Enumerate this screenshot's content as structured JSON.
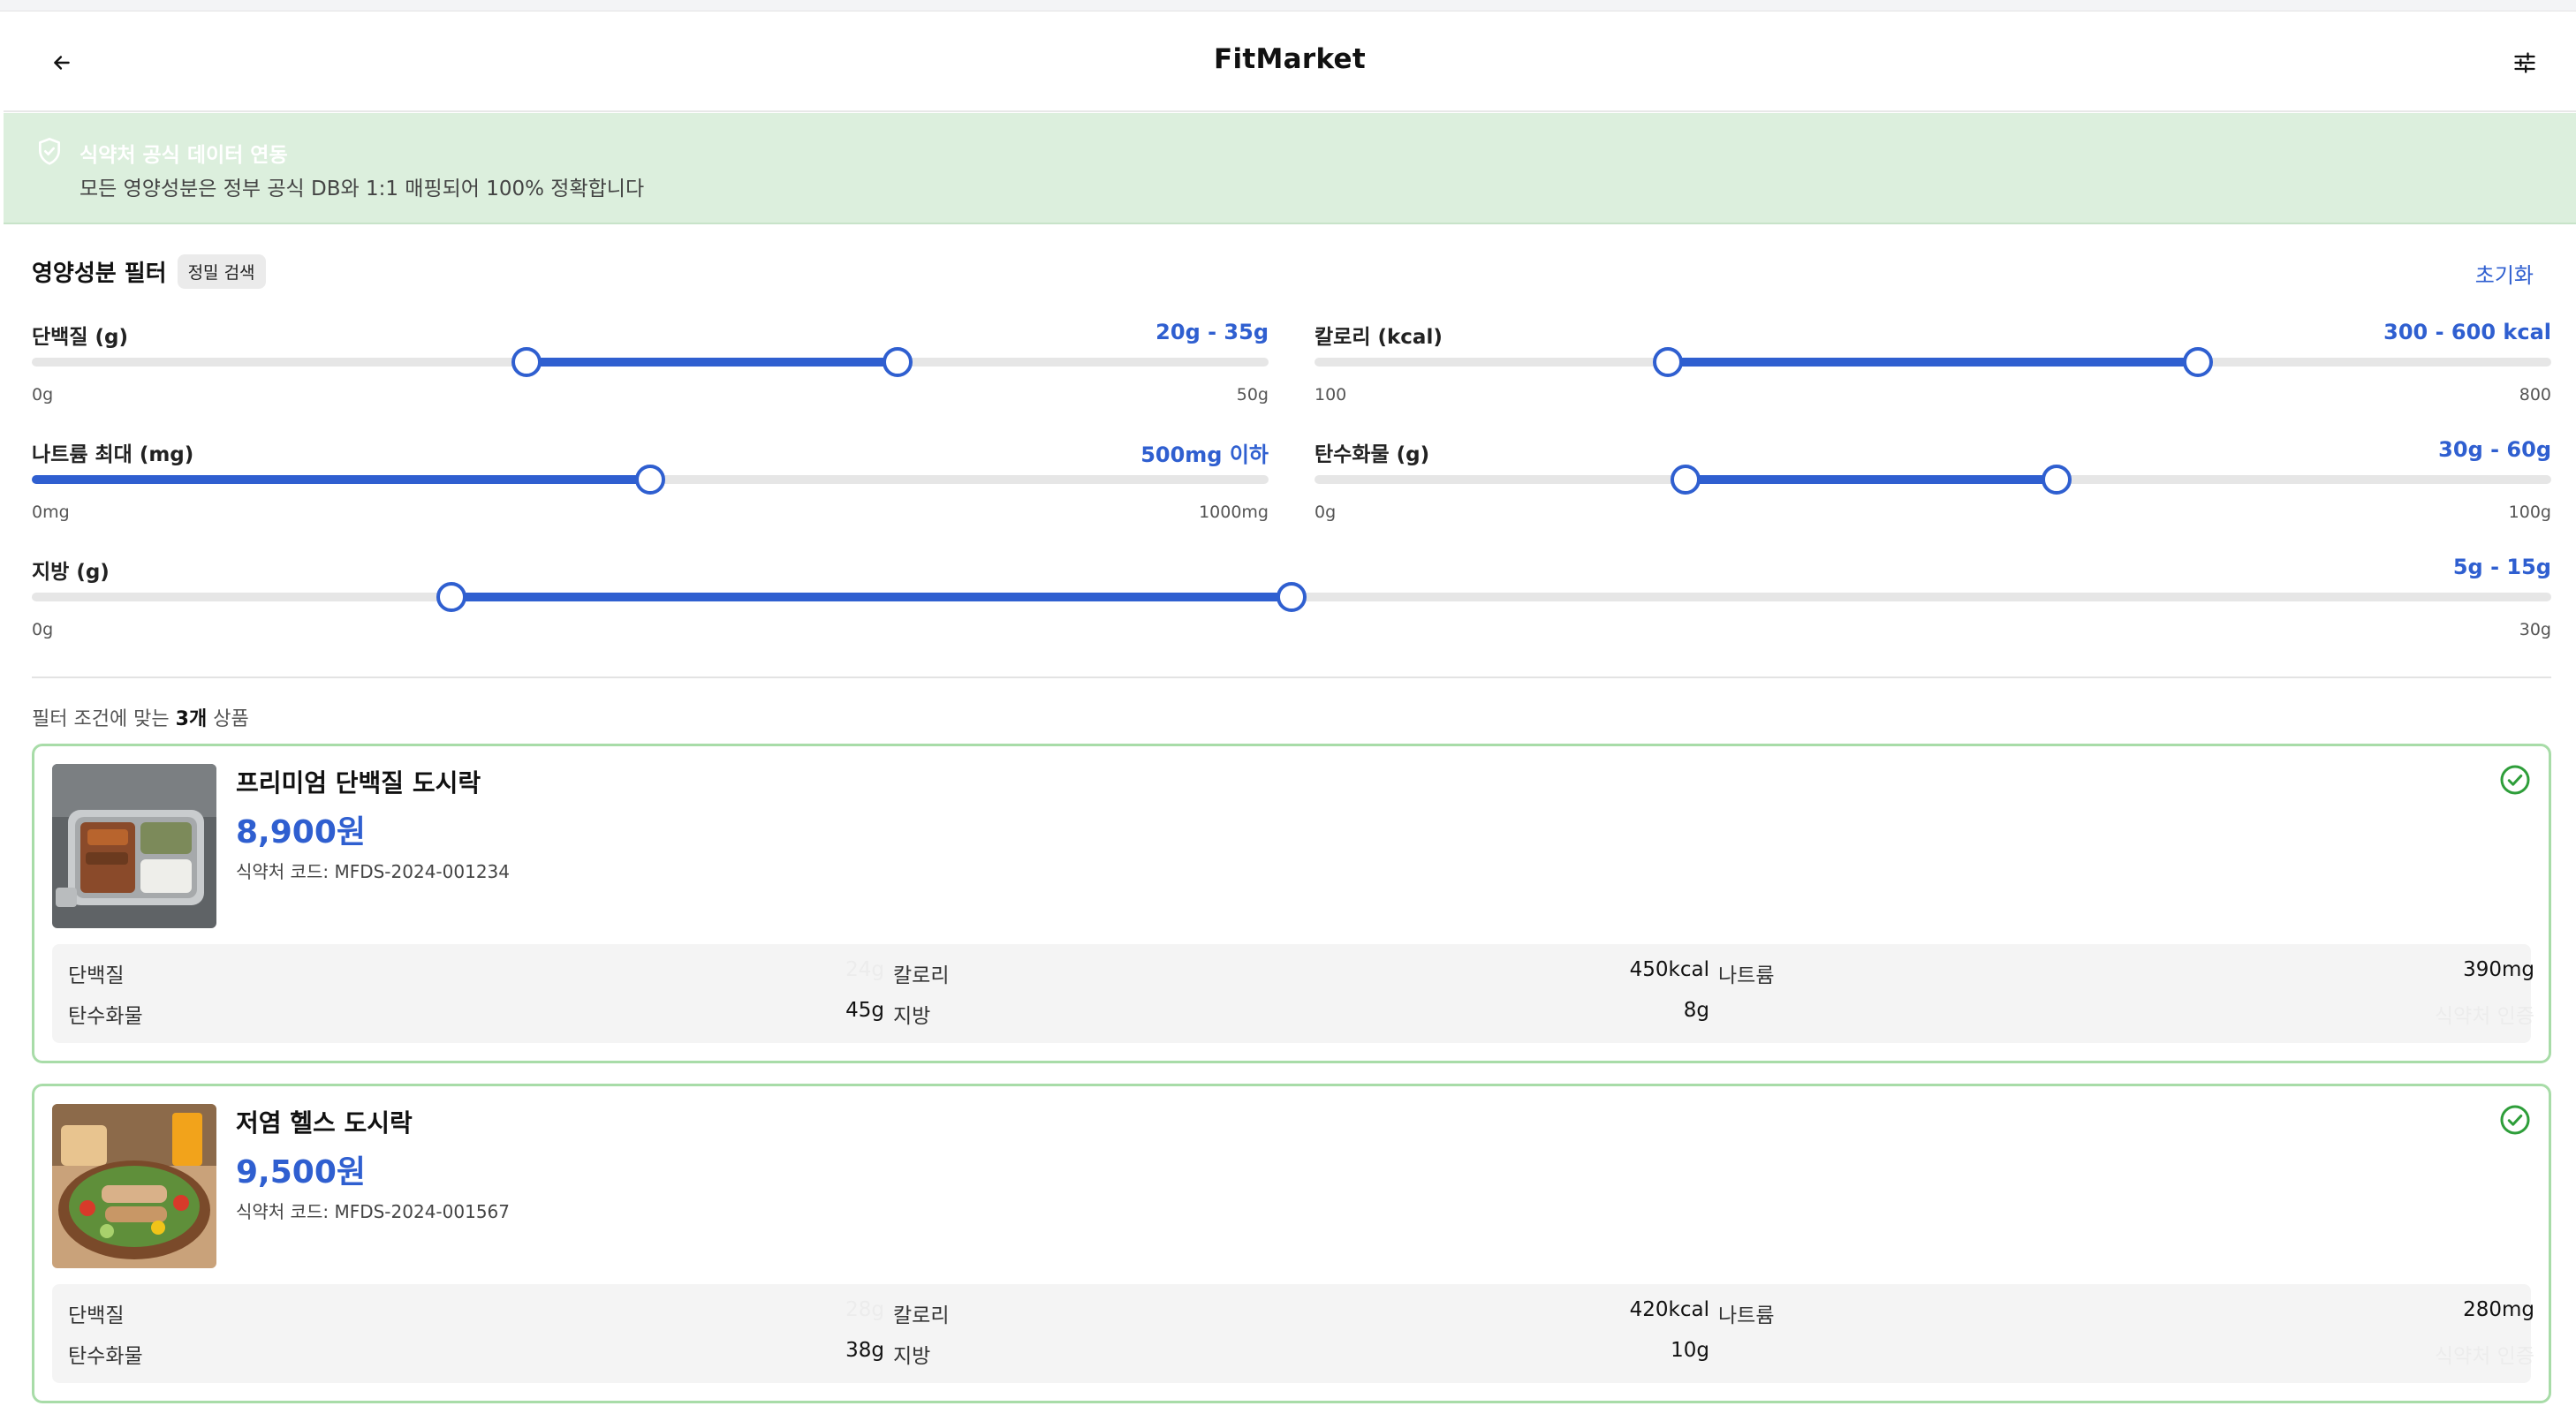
{
  "header": {
    "title": "FitMarket",
    "back_icon": "arrow-left-icon",
    "settings_icon": "sliders-icon"
  },
  "banner": {
    "title": "식약처 공식 데이터 연동",
    "subtitle": "모든 영양성분은 정부 공식 DB와 1:1 매핑되어 100% 정확합니다",
    "icon": "shield-check-icon"
  },
  "filter": {
    "title": "영양성분 필터",
    "tag": "정밀 검색",
    "reset_label": "초기화",
    "sliders": [
      {
        "label": "단백질 (g)",
        "value": "20g - 35g",
        "min": "0g",
        "max": "50g",
        "low": 20,
        "high": 35,
        "range": [
          0,
          50
        ]
      },
      {
        "label": "칼로리 (kcal)",
        "value": "300 - 600 kcal",
        "min": "100",
        "max": "800",
        "low": 300,
        "high": 600,
        "range": [
          100,
          800
        ]
      },
      {
        "label": "나트륨 최대 (mg)",
        "value": "500mg 이하",
        "min": "0mg",
        "max": "1000mg",
        "low": 0,
        "high": 500,
        "range": [
          0,
          1000
        ]
      },
      {
        "label": "탄수화물 (g)",
        "value": "30g - 60g",
        "min": "0g",
        "max": "100g",
        "low": 30,
        "high": 60,
        "range": [
          0,
          100
        ]
      },
      {
        "label": "지방 (g)",
        "value": "5g - 15g",
        "min": "0g",
        "max": "30g",
        "low": 5,
        "high": 15,
        "range": [
          0,
          30
        ]
      }
    ]
  },
  "results": {
    "prefix": "필터 조건에 맞는 ",
    "count": "3개",
    "suffix": " 상품"
  },
  "products": [
    {
      "name": "프리미엄 단백질 도시락",
      "price": "8,900원",
      "code": "식약처 코드: MFDS-2024-001234",
      "image_icon": "lunchbox-photo",
      "nutrition": {
        "protein_label": "단백질",
        "protein": "24g",
        "calorie_label": "칼로리",
        "calorie": "450kcal",
        "sodium_label": "나트륨",
        "sodium": "390mg",
        "carb_label": "탄수화물",
        "carb": "45g",
        "fat_label": "지방",
        "fat": "8g",
        "extra": "식약처 인증"
      }
    },
    {
      "name": "저염 헬스 도시락",
      "price": "9,500원",
      "code": "식약처 코드: MFDS-2024-001567",
      "image_icon": "salad-photo",
      "nutrition": {
        "protein_label": "단백질",
        "protein": "28g",
        "calorie_label": "칼로리",
        "calorie": "420kcal",
        "sodium_label": "나트륨",
        "sodium": "280mg",
        "carb_label": "탄수화물",
        "carb": "38g",
        "fat_label": "지방",
        "fat": "10g",
        "extra": "식약처 인증"
      }
    }
  ],
  "colors": {
    "accent": "#2f5fd0",
    "banner_bg": "#dcefdd",
    "card_border": "#a8dca8",
    "check": "#2e9e3a"
  }
}
